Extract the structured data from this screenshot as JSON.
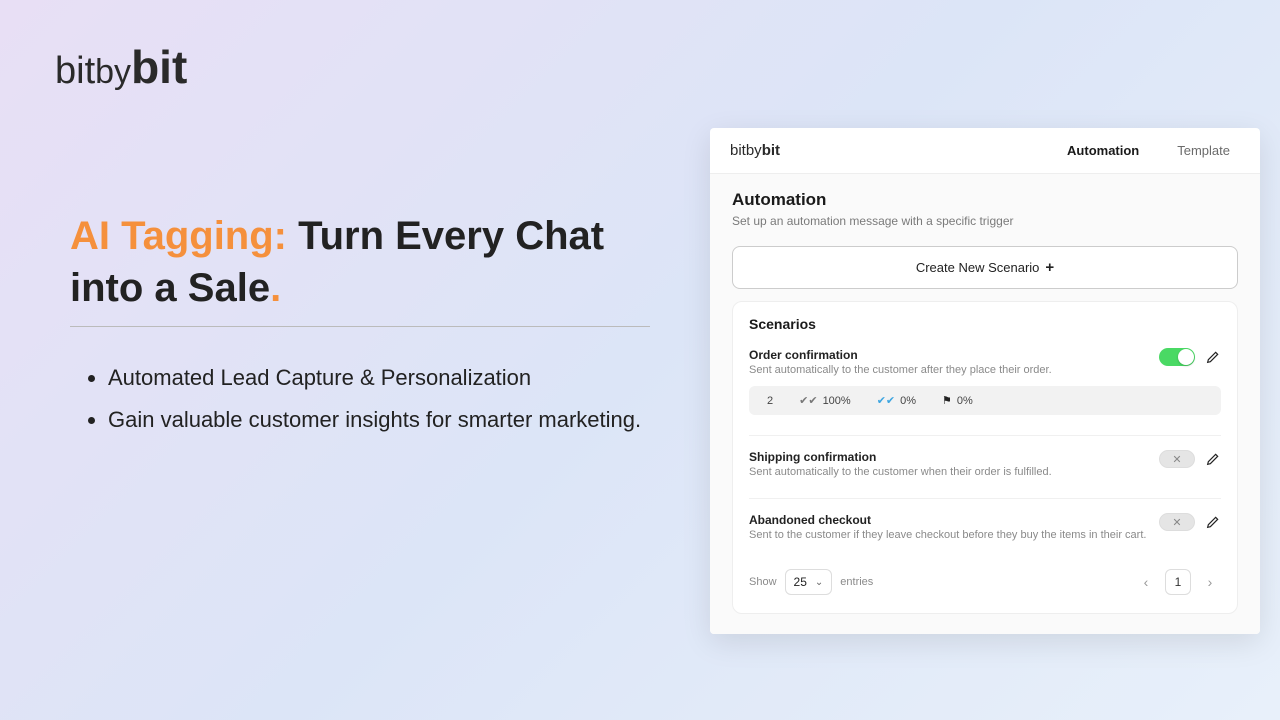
{
  "logo": {
    "part1": "bit",
    "part2": "by",
    "part3": "bit"
  },
  "headline": {
    "highlight": "AI Tagging:",
    "rest": " Turn Every Chat into a Sale",
    "dot": "."
  },
  "bullets": [
    "Automated Lead Capture & Personalization",
    "Gain valuable customer insights for smarter marketing."
  ],
  "app": {
    "logo": {
      "part1": "bit",
      "part2": "by",
      "part3": "bit"
    },
    "tabs": [
      {
        "label": "Automation",
        "active": true
      },
      {
        "label": "Template",
        "active": false
      }
    ],
    "section": {
      "title": "Automation",
      "subtitle": "Set up an automation message with a specific trigger"
    },
    "create_button": "Create New Scenario",
    "scenarios_title": "Scenarios",
    "scenarios": [
      {
        "name": "Order confirmation",
        "desc": "Sent automatically to the customer after they place their order.",
        "enabled": true,
        "stats": {
          "count": "2",
          "delivered": "100%",
          "opened": "0%",
          "flag": "0%"
        }
      },
      {
        "name": "Shipping confirmation",
        "desc": "Sent automatically to the customer when their order is fulfilled.",
        "enabled": false
      },
      {
        "name": "Abandoned checkout",
        "desc": "Sent to the customer if they leave checkout before they buy the items in their cart.",
        "enabled": false
      }
    ],
    "pagination": {
      "show_label": "Show",
      "page_size": "25",
      "entries_label": "entries",
      "current_page": "1"
    }
  }
}
